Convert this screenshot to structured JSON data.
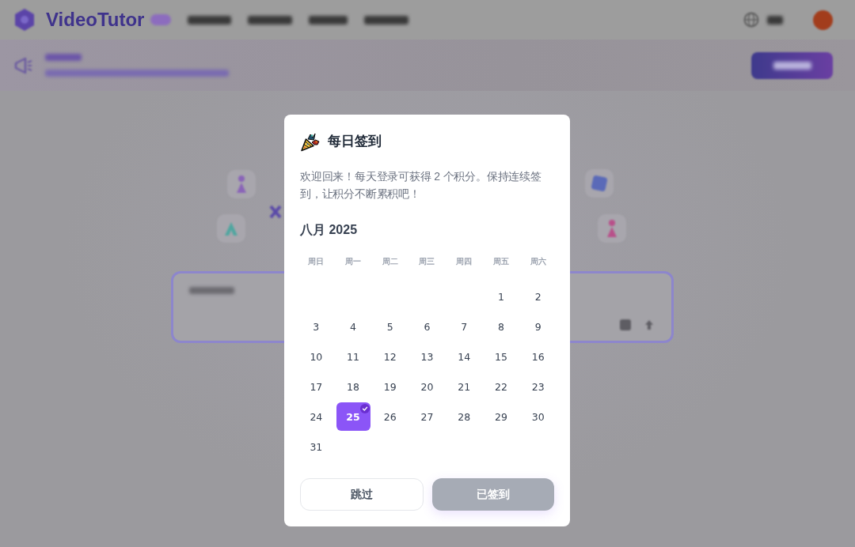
{
  "background_page": {
    "header": {
      "brand": "VideoTutor"
    }
  },
  "dialog": {
    "title": "每日签到",
    "message": "欢迎回来！每天登录可获得 2 个积分。保持连续签到，让积分不断累积吧！",
    "calendar": {
      "month_label": "八月 2025",
      "weekdays": [
        "周日",
        "周一",
        "周二",
        "周三",
        "周四",
        "周五",
        "周六"
      ],
      "days": [
        {
          "kind": "blank"
        },
        {
          "kind": "blank"
        },
        {
          "kind": "blank"
        },
        {
          "kind": "blank"
        },
        {
          "kind": "blank"
        },
        {
          "kind": "day",
          "label": "1",
          "selected": false,
          "checked_in": false
        },
        {
          "kind": "day",
          "label": "2",
          "selected": false,
          "checked_in": false
        },
        {
          "kind": "day",
          "label": "3",
          "selected": false,
          "checked_in": false
        },
        {
          "kind": "day",
          "label": "4",
          "selected": false,
          "checked_in": false
        },
        {
          "kind": "day",
          "label": "5",
          "selected": false,
          "checked_in": false
        },
        {
          "kind": "day",
          "label": "6",
          "selected": false,
          "checked_in": false
        },
        {
          "kind": "day",
          "label": "7",
          "selected": false,
          "checked_in": false
        },
        {
          "kind": "day",
          "label": "8",
          "selected": false,
          "checked_in": false
        },
        {
          "kind": "day",
          "label": "9",
          "selected": false,
          "checked_in": false
        },
        {
          "kind": "day",
          "label": "10",
          "selected": false,
          "checked_in": false
        },
        {
          "kind": "day",
          "label": "11",
          "selected": false,
          "checked_in": false
        },
        {
          "kind": "day",
          "label": "12",
          "selected": false,
          "checked_in": false
        },
        {
          "kind": "day",
          "label": "13",
          "selected": false,
          "checked_in": false
        },
        {
          "kind": "day",
          "label": "14",
          "selected": false,
          "checked_in": false
        },
        {
          "kind": "day",
          "label": "15",
          "selected": false,
          "checked_in": false
        },
        {
          "kind": "day",
          "label": "16",
          "selected": false,
          "checked_in": false
        },
        {
          "kind": "day",
          "label": "17",
          "selected": false,
          "checked_in": false
        },
        {
          "kind": "day",
          "label": "18",
          "selected": false,
          "checked_in": false
        },
        {
          "kind": "day",
          "label": "19",
          "selected": false,
          "checked_in": false
        },
        {
          "kind": "day",
          "label": "20",
          "selected": false,
          "checked_in": false
        },
        {
          "kind": "day",
          "label": "21",
          "selected": false,
          "checked_in": false
        },
        {
          "kind": "day",
          "label": "22",
          "selected": false,
          "checked_in": false
        },
        {
          "kind": "day",
          "label": "23",
          "selected": false,
          "checked_in": false
        },
        {
          "kind": "day",
          "label": "24",
          "selected": false,
          "checked_in": false
        },
        {
          "kind": "day",
          "label": "25",
          "selected": true,
          "checked_in": true
        },
        {
          "kind": "day",
          "label": "26",
          "selected": false,
          "checked_in": false
        },
        {
          "kind": "day",
          "label": "27",
          "selected": false,
          "checked_in": false
        },
        {
          "kind": "day",
          "label": "28",
          "selected": false,
          "checked_in": false
        },
        {
          "kind": "day",
          "label": "29",
          "selected": false,
          "checked_in": false
        },
        {
          "kind": "day",
          "label": "30",
          "selected": false,
          "checked_in": false
        },
        {
          "kind": "day",
          "label": "31",
          "selected": false,
          "checked_in": false
        }
      ]
    },
    "buttons": [
      {
        "label": "跳过",
        "kind": "outline",
        "disabled": false
      },
      {
        "label": "已签到",
        "kind": "primary",
        "disabled": true
      }
    ]
  }
}
